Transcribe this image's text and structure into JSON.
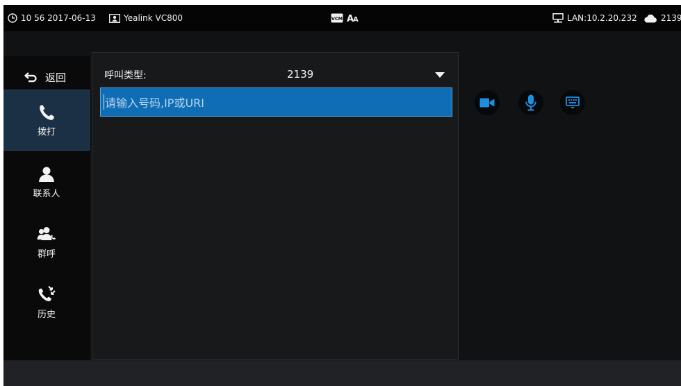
{
  "statusbar": {
    "time": "10 56 2017-06-13",
    "device_name": "Yealink VC800",
    "lan": "LAN:10.2.20.232",
    "account": "2139"
  },
  "nav": {
    "back_label": "返回",
    "items": [
      {
        "label": "拨打",
        "icon": "phone-icon",
        "active": true
      },
      {
        "label": "联系人",
        "icon": "contact-icon",
        "active": false
      },
      {
        "label": "群呼",
        "icon": "group-call-icon",
        "active": false
      },
      {
        "label": "历史",
        "icon": "history-icon",
        "active": false
      }
    ]
  },
  "dial": {
    "call_type_label": "呼叫类型:",
    "call_type_value": "2139",
    "input_value": "",
    "placeholder": "请输入号码,IP或URI"
  },
  "actions": [
    "video-call-icon",
    "microphone-icon",
    "keyboard-icon"
  ],
  "colors": {
    "accent": "#0e6db4",
    "action_icon": "#1e8fe0",
    "background": "#111214"
  }
}
